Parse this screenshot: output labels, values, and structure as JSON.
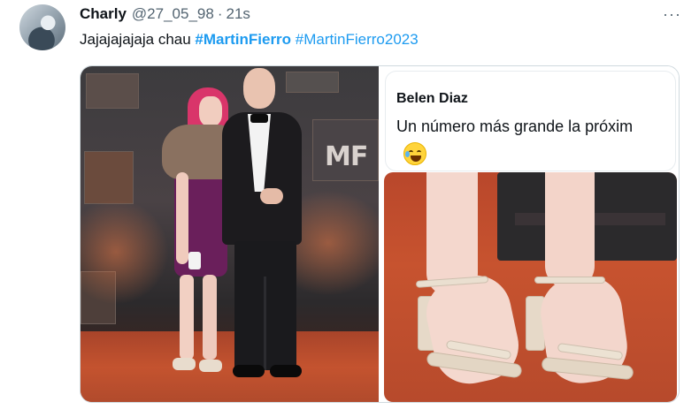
{
  "tweet": {
    "author_name": "Charly",
    "author_handle": "@27_05_98",
    "separator": "·",
    "time": "21s",
    "more_label": "···",
    "text_plain": "Jajajajajaja chau ",
    "hashtag_1": "#MartinFierro",
    "hashtag_2": "#MartinFierro2023"
  },
  "media": {
    "left_photo_logo": "MF",
    "quote": {
      "name": "Belen Diaz",
      "text": "Un número más grande la próxim",
      "emoji": "face-with-tears-of-joy"
    }
  },
  "colors": {
    "link": "#1d9bf0",
    "text": "#0f1419",
    "secondary": "#536471",
    "border": "#cfd9de"
  }
}
